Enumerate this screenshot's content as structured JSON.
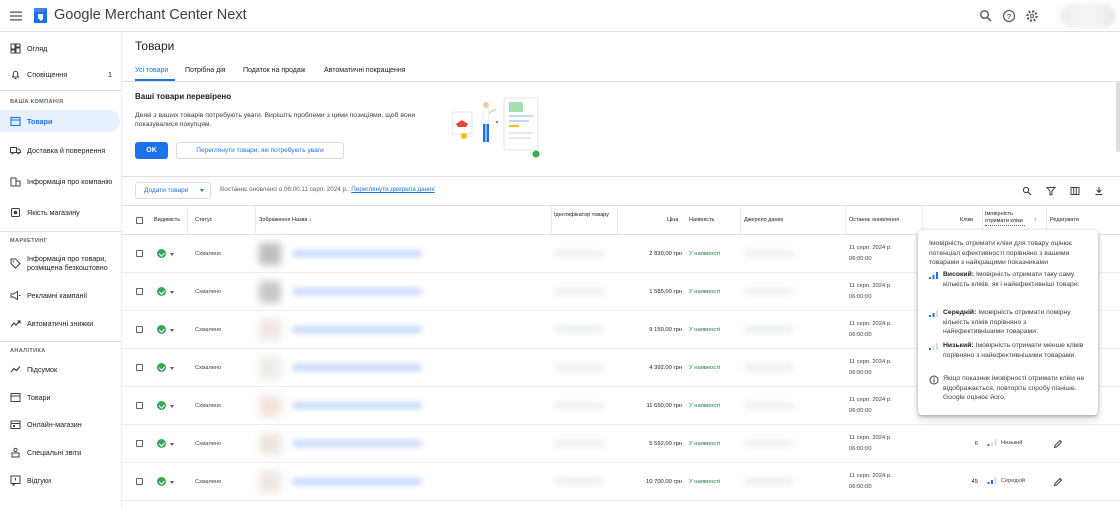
{
  "app": {
    "title": "Google Merchant Center Next"
  },
  "sidebar": {
    "items": [
      {
        "label": "Огляд",
        "icon": "dashboard-icon"
      },
      {
        "label": "Сповіщення",
        "icon": "bell-icon",
        "count": "1"
      },
      {
        "label": "Товари",
        "icon": "products-icon",
        "active": true
      },
      {
        "label": "Доставка й повернення",
        "icon": "truck-icon"
      },
      {
        "label": "Інформація про компанію",
        "icon": "business-icon"
      },
      {
        "label": "Якість магазину",
        "icon": "store-quality-icon"
      },
      {
        "label": "Інформація про товари, розміщена безкоштовно",
        "icon": "tag-icon"
      },
      {
        "label": "Рекламні кампанії",
        "icon": "megaphone-icon"
      },
      {
        "label": "Автоматичні знижки",
        "icon": "trend-icon"
      },
      {
        "label": "Підсумок",
        "icon": "chart-line-icon"
      },
      {
        "label": "Товари",
        "icon": "products-icon"
      },
      {
        "label": "Онлайн-магазин",
        "icon": "storefront-icon"
      },
      {
        "label": "Спеціальні звіти",
        "icon": "report-icon"
      },
      {
        "label": "Відгуки",
        "icon": "feedback-icon"
      }
    ],
    "sections": {
      "company": "ВАША КОМПАНІЯ",
      "marketing": "МАРКЕТИНГ",
      "analytics": "АНАЛІТИКА"
    }
  },
  "main": {
    "title": "Товари",
    "tabs": [
      "Усі товари",
      "Потрібна дія",
      "Податок на продаж",
      "Автоматичні покращення"
    ],
    "banner": {
      "title": "Ваші товари перевірено",
      "description": "Деякі з ваших товарів потребують уваги. Вирішіть проблеми з цими позиціями, щоб вони показувалися покупцям.",
      "ok": "OK",
      "view": "Переглянути товари, які потребують уваги"
    },
    "toolbar": {
      "add": "Додати товари",
      "updated": "Востаннє оновлено о 06:00:11 серп. 2024 р..",
      "sources_link": "Переглянути джерела даних"
    },
    "columns": {
      "visibility": "Видимість",
      "status": "Статус",
      "image": "Зображення",
      "name": "Назва ↓",
      "id": "Ідентифікатор товару",
      "price": "Ціна",
      "availability": "Наявність",
      "source": "Джерело даних",
      "last_update": "Останнє оновлення",
      "clicks": "Кліки",
      "click_prob": "Імовірність отримати кліки",
      "edit": "Редагувати"
    },
    "rows": [
      {
        "status": "Схвалено",
        "price": "2 830,00 грн",
        "avail": "У наявності",
        "date": "11 серп. 2024 р.",
        "time": "06:00:00",
        "clicks": "",
        "level": ""
      },
      {
        "status": "Схвалено",
        "price": "1 585,00 грн",
        "avail": "У наявності",
        "date": "11 серп. 2024 р.",
        "time": "06:00:00",
        "clicks": "",
        "level": ""
      },
      {
        "status": "Схвалено",
        "price": "9 150,00 грн",
        "avail": "У наявності",
        "date": "11 серп. 2024 р.",
        "time": "06:00:00",
        "clicks": "",
        "level": ""
      },
      {
        "status": "Схвалено",
        "price": "4 392,00 грн",
        "avail": "У наявності",
        "date": "11 серп. 2024 р.",
        "time": "06:00:00",
        "clicks": "",
        "level": ""
      },
      {
        "status": "Схвалено",
        "price": "11 650,00 грн",
        "avail": "У наявності",
        "date": "11 серп. 2024 р.",
        "time": "06:00:00",
        "clicks": "",
        "level": ""
      },
      {
        "status": "Схвалено",
        "price": "5 592,00 грн",
        "avail": "У наявності",
        "date": "11 серп. 2024 р.",
        "time": "06:00:00",
        "clicks": "6",
        "level": "Низький"
      },
      {
        "status": "Схвалено",
        "price": "10 700,00 грн",
        "avail": "У наявності",
        "date": "11 серп. 2024 р.",
        "time": "06:00:00",
        "clicks": "45",
        "level": "Середній"
      }
    ]
  },
  "tooltip": {
    "intro": "Імовірність отримати кліки для товару оцінює потенціал ефективності порівняно з вашими товарами з найкращими показниками",
    "high_label": "Високий:",
    "high_text": "Імовірність отримати таку саму кількість кліків, як і найефективніші товари.",
    "mid_label": "Середній:",
    "mid_text": "Імовірність отримати помірну кількість кліків порівняно з найефективнішими товарами.",
    "low_label": "Низький:",
    "low_text": "Імовірність отримати менше кліків порівняно з найефективнішими товарами.",
    "note": "Якщо показник імовірності отримати кліки не відображається, повторіть спробу пізніше. Google оцінює його."
  },
  "colors": {
    "accent": "#1a73e8",
    "success": "#34a853"
  }
}
